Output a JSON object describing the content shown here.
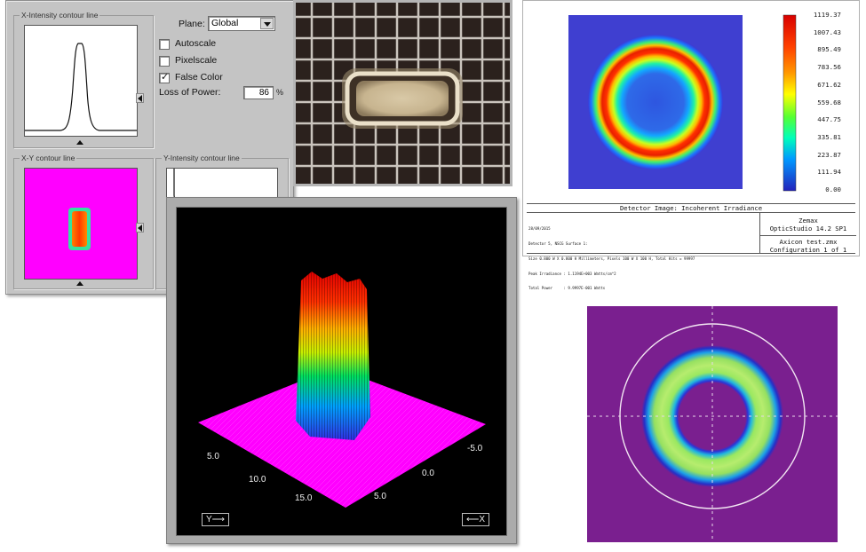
{
  "analysis_window": {
    "x_intensity_title": "X-Intensity contour line",
    "xy_contour_title": "X-Y contour line",
    "y_intensity_title": "Y-Intensity contour line",
    "plane_label": "Plane:",
    "plane_value": "Global",
    "autoscale_label": "Autoscale",
    "autoscale_checked": false,
    "pixelscale_label": "Pixelscale",
    "pixelscale_checked": false,
    "false_color_label": "False Color",
    "false_color_checked": true,
    "loss_of_power_label": "Loss of Power:",
    "loss_of_power_value": "86",
    "loss_of_power_unit": "%"
  },
  "detector_image": {
    "colorbar_ticks": [
      "1119.37",
      "1007.43",
      "895.49",
      "783.56",
      "671.62",
      "559.68",
      "447.75",
      "335.81",
      "223.87",
      "111.94",
      "0.00"
    ],
    "caption": "Detector Image: Incoherent Irradiance",
    "footer_left_lines": [
      "28/09/2015",
      "Detector 5, NSCG Surface 1:",
      "Size 0.800 W X 0.800 H Millimeters, Pixels 100 W X 100 H, Total Hits = 99997",
      "Peak Irradiance : 1.1194E+003 Watts/cm^2",
      "Total Power     : 9.9997E-001 Watts"
    ],
    "brand": "Zemax",
    "version": "OpticStudio 14.2 SP1",
    "file": "Axicon test.zmx",
    "configuration": "Configuration 1 of 1"
  },
  "surface_plot": {
    "y_ticks": [
      "5.0",
      "10.0",
      "15.0"
    ],
    "x_ticks": [
      "-5.0",
      "0.0",
      "5.0"
    ],
    "y_button": "Y⟶",
    "x_button": "⟵X"
  },
  "colors": {
    "window_gray": "#c4c4c4",
    "magenta": "#ff00ff",
    "detector_background": "#3f3fd0",
    "ring_background": "#7a1f8f"
  }
}
